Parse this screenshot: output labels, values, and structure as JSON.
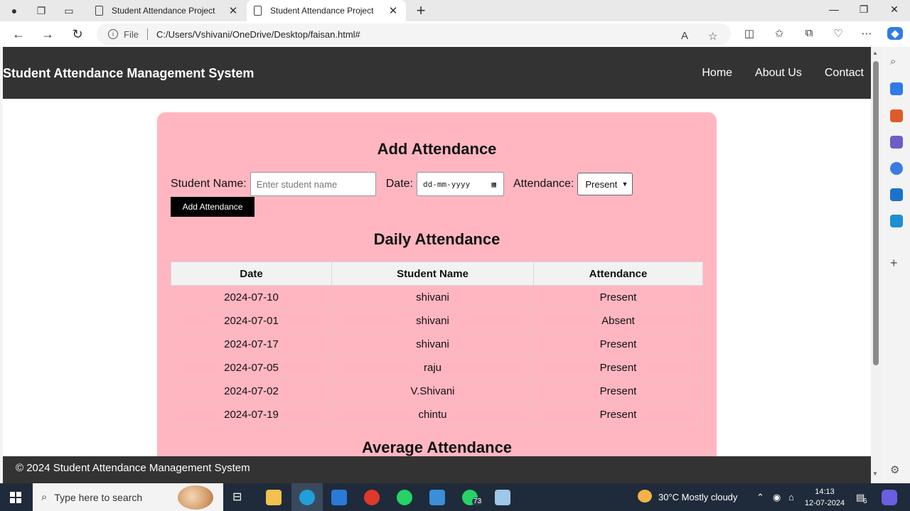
{
  "browser": {
    "tabs": [
      {
        "title": "Student Attendance Project",
        "active": false
      },
      {
        "title": "Student Attendance Project",
        "active": true
      }
    ],
    "address": {
      "scheme_label": "File",
      "url": "C:/Users/Vshivani/OneDrive/Desktop/faisan.html#"
    }
  },
  "site": {
    "title": "Student Attendance Management System",
    "nav": [
      "Home",
      "About Us",
      "Contact"
    ],
    "footer": "© 2024 Student Attendance Management System"
  },
  "form": {
    "heading": "Add Attendance",
    "student_label": "Student Name:",
    "student_placeholder": "Enter student name",
    "date_label": "Date:",
    "date_placeholder": "dd-mm-yyyy",
    "attendance_label": "Attendance:",
    "attendance_selected": "Present",
    "submit_label": "Add Attendance"
  },
  "daily": {
    "heading": "Daily Attendance",
    "columns": [
      "Date",
      "Student Name",
      "Attendance"
    ],
    "rows": [
      [
        "2024-07-10",
        "shivani",
        "Present"
      ],
      [
        "2024-07-01",
        "shivani",
        "Absent"
      ],
      [
        "2024-07-17",
        "shivani",
        "Present"
      ],
      [
        "2024-07-05",
        "raju",
        "Present"
      ],
      [
        "2024-07-02",
        "V.Shivani",
        "Present"
      ],
      [
        "2024-07-19",
        "chintu",
        "Present"
      ]
    ]
  },
  "average": {
    "heading": "Average Attendance"
  },
  "taskbar": {
    "search_placeholder": "Type here to search",
    "whatsapp_badge": "73",
    "weather": "30°C  Mostly cloudy",
    "time": "14:13",
    "date": "12-07-2024",
    "notification_count": "6"
  },
  "colors": {
    "header_bg": "#333333",
    "card_bg": "#ffb6c1",
    "button_bg": "#000000"
  }
}
